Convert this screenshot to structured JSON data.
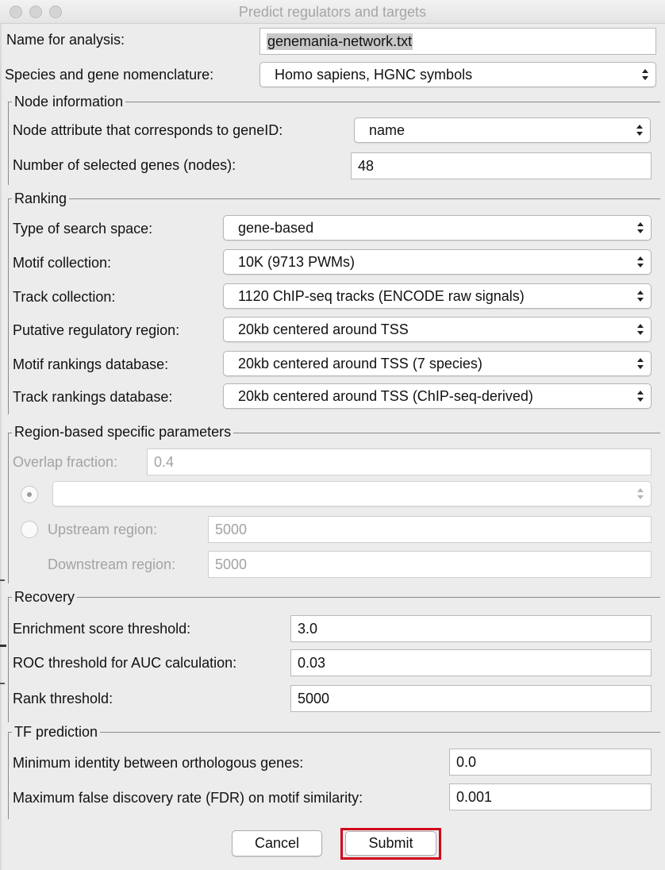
{
  "window": {
    "title": "Predict regulators and targets"
  },
  "analysis": {
    "name_label": "Name for analysis:",
    "name_value": "genemania-network.txt",
    "species_label": "Species and gene nomenclature:",
    "species_value": "Homo sapiens, HGNC symbols"
  },
  "node_info": {
    "title": "Node information",
    "attribute_label": "Node attribute that corresponds to geneID:",
    "attribute_value": "name",
    "selected_label": "Number of selected genes (nodes):",
    "selected_value": "48"
  },
  "ranking": {
    "title": "Ranking",
    "search_space_label": "Type of search space:",
    "search_space_value": "gene-based",
    "motif_collection_label": "Motif collection:",
    "motif_collection_value": "10K (9713 PWMs)",
    "track_collection_label": "Track collection:",
    "track_collection_value": "1120 ChIP-seq tracks (ENCODE raw signals)",
    "regulatory_region_label": "Putative regulatory region:",
    "regulatory_region_value": "20kb centered around TSS",
    "motif_db_label": "Motif rankings database:",
    "motif_db_value": "20kb centered around TSS (7 species)",
    "track_db_label": "Track rankings database:",
    "track_db_value": "20kb centered around TSS (ChIP-seq-derived)"
  },
  "region": {
    "title": "Region-based specific parameters",
    "overlap_label": "Overlap fraction:",
    "overlap_value": "0.4",
    "combo_value": "",
    "upstream_label": "Upstream region:",
    "upstream_value": "5000",
    "downstream_label": "Downstream region:",
    "downstream_value": "5000"
  },
  "recovery": {
    "title": "Recovery",
    "enrichment_label": "Enrichment score threshold:",
    "enrichment_value": "3.0",
    "roc_label": "ROC threshold for AUC calculation:",
    "roc_value": "0.03",
    "rank_label": "Rank threshold:",
    "rank_value": "5000"
  },
  "tf": {
    "title": "TF prediction",
    "identity_label": "Minimum identity between orthologous genes:",
    "identity_value": "0.0",
    "fdr_label": "Maximum false discovery rate (FDR) on motif similarity:",
    "fdr_value": "0.001"
  },
  "buttons": {
    "cancel": "Cancel",
    "submit": "Submit"
  },
  "colors": {
    "highlight": "#d0021b",
    "window_bg": "#ececec"
  }
}
